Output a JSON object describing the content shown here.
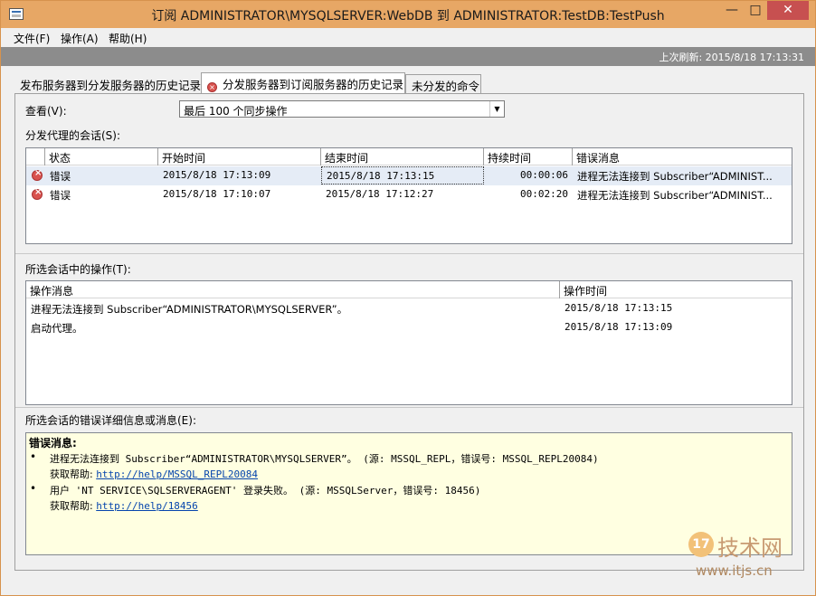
{
  "window": {
    "title": "订阅 ADMINISTRATOR\\MYSQLSERVER:WebDB 到 ADMINISTRATOR:TestDB:TestPush",
    "min_label": "—",
    "max_label": "□",
    "close_label": "✕"
  },
  "menu": [
    "文件(F)",
    "操作(A)",
    "帮助(H)"
  ],
  "refresh": {
    "text": "上次刷新: 2015/8/18 17:13:31"
  },
  "tabs": [
    {
      "label": "发布服务器到分发服务器的历史记录"
    },
    {
      "label": "分发服务器到订阅服务器的历史记录",
      "icon": "error-icon",
      "active": true
    },
    {
      "label": "未分发的命令"
    }
  ],
  "view": {
    "label": "查看(V):",
    "selected": "最后 100 个同步操作"
  },
  "sessions": {
    "label": "分发代理的会话(S):",
    "columns": [
      "状态",
      "开始时间",
      "结束时间",
      "持续时间",
      "错误消息"
    ],
    "rows": [
      {
        "status": "错误",
        "start": "2015/8/18 17:13:09",
        "end": "2015/8/18 17:13:15",
        "duration": "00:00:06",
        "message": "进程无法连接到 Subscriber“ADMINIST..."
      },
      {
        "status": "错误",
        "start": "2015/8/18 17:10:07",
        "end": "2015/8/18 17:12:27",
        "duration": "00:02:20",
        "message": "进程无法连接到 Subscriber“ADMINIST..."
      }
    ]
  },
  "actions": {
    "label": "所选会话中的操作(T):",
    "columns": [
      "操作消息",
      "操作时间"
    ],
    "rows": [
      {
        "message": "进程无法连接到 Subscriber“ADMINISTRATOR\\MYSQLSERVER”。",
        "time": "2015/8/18 17:13:15"
      },
      {
        "message": "启动代理。",
        "time": "2015/8/18 17:13:09"
      }
    ]
  },
  "details": {
    "label": "所选会话的错误详细信息或消息(E):",
    "title": "错误消息:",
    "items": [
      {
        "text": "进程无法连接到 Subscriber“ADMINISTRATOR\\MYSQLSERVER”。 (源: MSSQL_REPL，错误号: MSSQL_REPL20084)",
        "help_label": "获取帮助:",
        "help_link": "http://help/MSSQL_REPL20084"
      },
      {
        "text": "用户 'NT SERVICE\\SQLSERVERAGENT' 登录失败。 (源: MSSQLServer，错误号: 18456)",
        "help_label": "获取帮助:",
        "help_link": "http://help/18456"
      }
    ]
  },
  "watermark": {
    "badge": "17",
    "text": "技术网",
    "url": "www.itjs.cn"
  },
  "colors": {
    "titlebar": "#e7a765",
    "refresh_bar": "#8c8c8c",
    "message_bg": "#ffffe1",
    "error": "#d9534f",
    "link": "#0645ad"
  }
}
